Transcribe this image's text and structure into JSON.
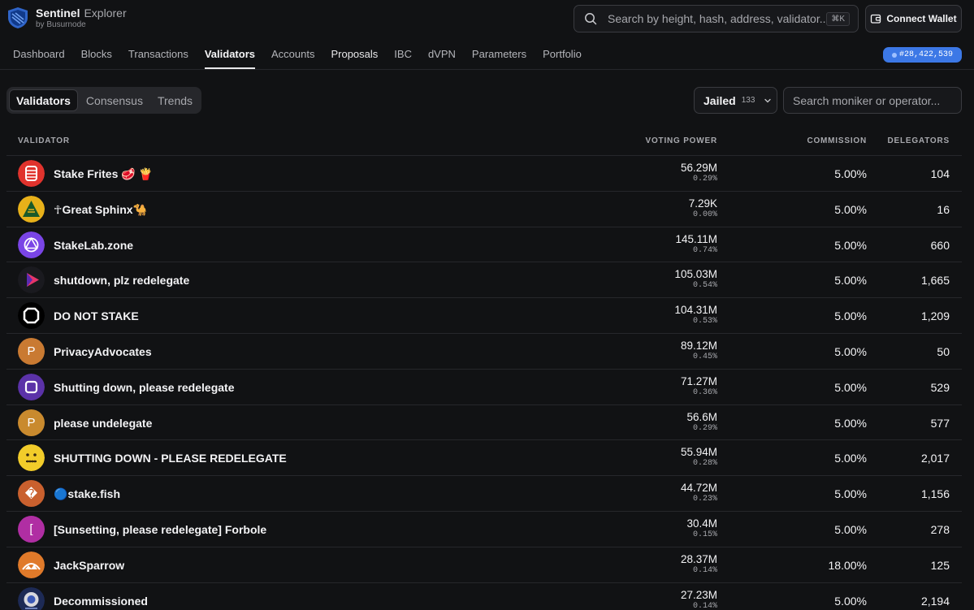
{
  "brand": {
    "name": "Sentinel",
    "suffix": "Explorer",
    "by": "by Busurnode"
  },
  "search": {
    "placeholder": "Search by height, hash, address, validator...",
    "shortcut": "⌘K"
  },
  "connect": {
    "label": "Connect Wallet"
  },
  "nav": [
    "Dashboard",
    "Blocks",
    "Transactions",
    "Validators",
    "Accounts",
    "Proposals",
    "IBC",
    "dVPN",
    "Parameters",
    "Portfolio"
  ],
  "block_height": "#28,422,539",
  "tabs": [
    "Validators",
    "Consensus",
    "Trends"
  ],
  "filter": {
    "label": "Jailed",
    "count": "133"
  },
  "moniker_search": {
    "placeholder": "Search moniker or operator..."
  },
  "columns": {
    "validator": "VALIDATOR",
    "voting_power": "VOTING POWER",
    "commission": "COMMISSION",
    "delegators": "DELEGATORS"
  },
  "validators": [
    {
      "name": "Stake Frites 🥩 🍟",
      "vp": "56.29M",
      "pct": "0.29%",
      "commission": "5.00%",
      "delegators": "104",
      "icon": "stake-frites",
      "color": "#e0332d"
    },
    {
      "name": "☥Great Sphinx🐪",
      "vp": "7.29K",
      "pct": "0.00%",
      "commission": "5.00%",
      "delegators": "16",
      "icon": "sphinx",
      "color": "#e8b11a"
    },
    {
      "name": "StakeLab.zone",
      "vp": "145.11M",
      "pct": "0.74%",
      "commission": "5.00%",
      "delegators": "660",
      "icon": "stakelab",
      "color": "#7a45e6"
    },
    {
      "name": "shutdown, plz redelegate",
      "vp": "105.03M",
      "pct": "0.54%",
      "commission": "5.00%",
      "delegators": "1,665",
      "icon": "play",
      "color": "#1a1a1f"
    },
    {
      "name": "DO NOT STAKE",
      "vp": "104.31M",
      "pct": "0.53%",
      "commission": "5.00%",
      "delegators": "1,209",
      "icon": "octagon",
      "color": "#000000"
    },
    {
      "name": "PrivacyAdvocates",
      "vp": "89.12M",
      "pct": "0.45%",
      "commission": "5.00%",
      "delegators": "50",
      "icon": "letter",
      "letter": "P",
      "color": "#c97a32"
    },
    {
      "name": "Shutting down, please redelegate",
      "vp": "71.27M",
      "pct": "0.36%",
      "commission": "5.00%",
      "delegators": "529",
      "icon": "frame",
      "color": "#5b32a8"
    },
    {
      "name": "please undelegate",
      "vp": "56.6M",
      "pct": "0.29%",
      "commission": "5.00%",
      "delegators": "577",
      "icon": "letter",
      "letter": "P",
      "color": "#c98a2e"
    },
    {
      "name": "SHUTTING DOWN - PLEASE REDELEGATE",
      "vp": "55.94M",
      "pct": "0.28%",
      "commission": "5.00%",
      "delegators": "2,017",
      "icon": "zipper-face",
      "color": "#f2cc2a"
    },
    {
      "name": "🔵stake.fish",
      "vp": "44.72M",
      "pct": "0.23%",
      "commission": "5.00%",
      "delegators": "1,156",
      "icon": "letter",
      "letter": "�",
      "color": "#c9602e"
    },
    {
      "name": "[Sunsetting, please redelegate] Forbole",
      "vp": "30.4M",
      "pct": "0.15%",
      "commission": "5.00%",
      "delegators": "278",
      "icon": "letter",
      "letter": "[",
      "color": "#b02ea3"
    },
    {
      "name": "JackSparrow",
      "vp": "28.37M",
      "pct": "0.14%",
      "commission": "18.00%",
      "delegators": "125",
      "icon": "sunset",
      "color": "#e07a2a"
    },
    {
      "name": "Decommissioned",
      "vp": "27.23M",
      "pct": "0.14%",
      "commission": "5.00%",
      "delegators": "2,194",
      "icon": "badge",
      "color": "#d8d8de"
    }
  ],
  "colors": {
    "accent": "#3c78e6",
    "background": "#111214",
    "border": "#26272b"
  }
}
